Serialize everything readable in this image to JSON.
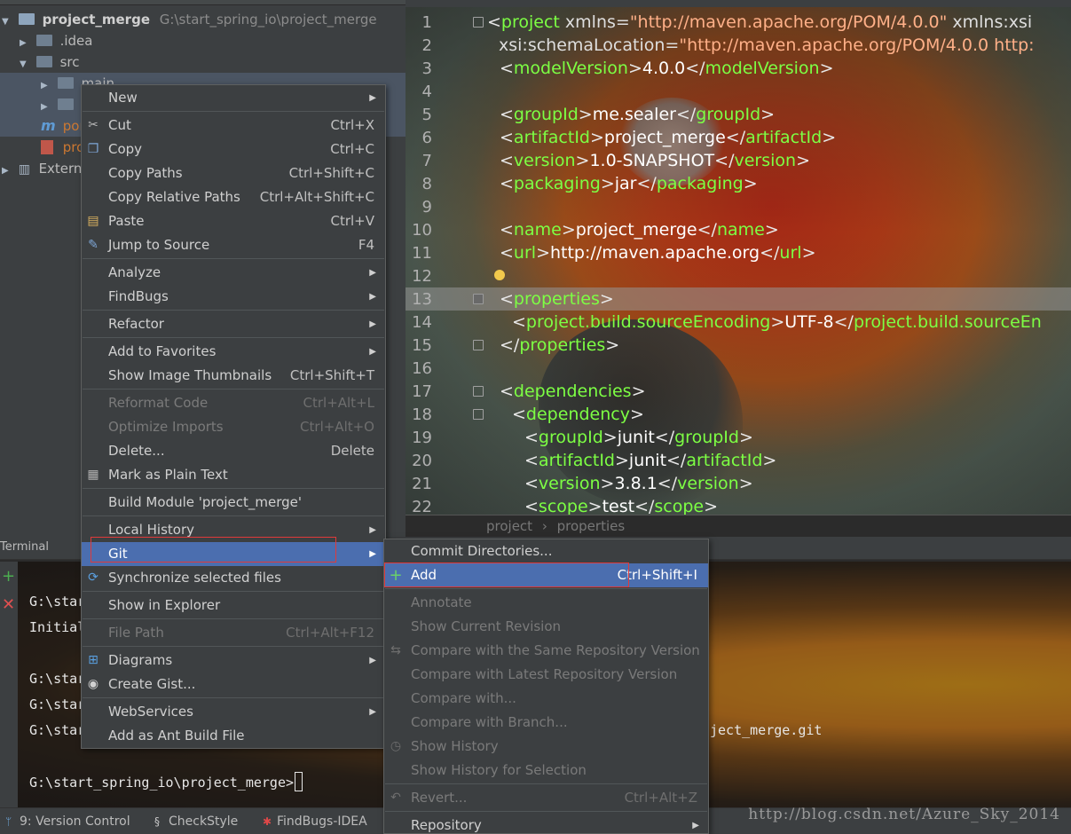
{
  "project": {
    "root_name": "project_merge",
    "root_path": "G:\\start_spring_io\\project_merge",
    "items": [
      {
        "label": ".idea"
      },
      {
        "label": "src"
      },
      {
        "label": "main"
      },
      {
        "label": ""
      },
      {
        "label": "pom"
      },
      {
        "label": "pro"
      },
      {
        "label": "Externa"
      }
    ]
  },
  "editor": {
    "lines": [
      {
        "n": "1"
      },
      {
        "n": "2"
      },
      {
        "n": "3"
      },
      {
        "n": "4"
      },
      {
        "n": "5"
      },
      {
        "n": "6"
      },
      {
        "n": "7"
      },
      {
        "n": "8"
      },
      {
        "n": "9"
      },
      {
        "n": "10"
      },
      {
        "n": "11"
      },
      {
        "n": "12"
      },
      {
        "n": "13"
      },
      {
        "n": "14"
      },
      {
        "n": "15"
      },
      {
        "n": "16"
      },
      {
        "n": "17"
      },
      {
        "n": "18"
      },
      {
        "n": "19"
      },
      {
        "n": "20"
      },
      {
        "n": "21"
      },
      {
        "n": "22"
      }
    ],
    "code": {
      "l1_tag": "project",
      "l1_attr1": " xmlns=",
      "l1_val1": "\"http://maven.apache.org/POM/4.0.0\"",
      "l1_attr2": " xmlns:xsi",
      "l2_attr": "xsi:schemaLocation=",
      "l2_val": "\"http://maven.apache.org/POM/4.0.0 http:",
      "modelVersion": "modelVersion",
      "modelVersion_val": "4.0.0",
      "groupId": "groupId",
      "groupId_val": "me.sealer",
      "artifactId": "artifactId",
      "artifactId_val": "project_merge",
      "version": "version",
      "version_val": "1.0-SNAPSHOT",
      "packaging": "packaging",
      "packaging_val": "jar",
      "name": "name",
      "name_val": "project_merge",
      "url": "url",
      "url_val": "http://maven.apache.org",
      "properties": "properties",
      "encoding": "project.build.sourceEncoding",
      "encoding_val": "UTF-8",
      "encoding_close": "project.build.sourceEn",
      "dependencies": "dependencies",
      "dependency": "dependency",
      "dep_groupId_val": "junit",
      "dep_artifactId_val": "junit",
      "dep_version_val": "3.8.1",
      "scope": "scope",
      "scope_val": "test"
    },
    "breadcrumb": [
      "project",
      "properties"
    ]
  },
  "terminal": {
    "title": "Terminal",
    "lines": [
      "G:\\star",
      "Initial",
      "G:\\star",
      "G:\\star",
      "G:\\star",
      "ject_merge.git",
      "G:\\start_spring_io\\project_merge>"
    ]
  },
  "statusbar": {
    "version_control": "9: Version Control",
    "checkstyle": "CheckStyle",
    "findbugs": "FindBugs-IDEA"
  },
  "watermark": "http://blog.csdn.net/Azure_Sky_2014",
  "context_menu": {
    "items": [
      {
        "label": "New"
      },
      {
        "label": "Cut",
        "shortcut": "Ctrl+X"
      },
      {
        "label": "Copy",
        "shortcut": "Ctrl+C"
      },
      {
        "label": "Copy Paths",
        "shortcut": "Ctrl+Shift+C"
      },
      {
        "label": "Copy Relative Paths",
        "shortcut": "Ctrl+Alt+Shift+C"
      },
      {
        "label": "Paste",
        "shortcut": "Ctrl+V"
      },
      {
        "label": "Jump to Source",
        "shortcut": "F4"
      },
      {
        "label": "Analyze"
      },
      {
        "label": "FindBugs"
      },
      {
        "label": "Refactor"
      },
      {
        "label": "Add to Favorites"
      },
      {
        "label": "Show Image Thumbnails",
        "shortcut": "Ctrl+Shift+T"
      },
      {
        "label": "Reformat Code",
        "shortcut": "Ctrl+Alt+L"
      },
      {
        "label": "Optimize Imports",
        "shortcut": "Ctrl+Alt+O"
      },
      {
        "label": "Delete...",
        "shortcut": "Delete"
      },
      {
        "label": "Mark as Plain Text"
      },
      {
        "label": "Build Module 'project_merge'"
      },
      {
        "label": "Local History"
      },
      {
        "label": "Git"
      },
      {
        "label": "Synchronize selected files"
      },
      {
        "label": "Show in Explorer"
      },
      {
        "label": "File Path",
        "shortcut": "Ctrl+Alt+F12"
      },
      {
        "label": "Diagrams"
      },
      {
        "label": "Create Gist..."
      },
      {
        "label": "WebServices"
      },
      {
        "label": "Add as Ant Build File"
      }
    ]
  },
  "git_menu": {
    "items": [
      {
        "label": "Commit Directories..."
      },
      {
        "label": "Add",
        "shortcut": "Ctrl+Shift+I"
      },
      {
        "label": "Annotate"
      },
      {
        "label": "Show Current Revision"
      },
      {
        "label": "Compare with the Same Repository Version"
      },
      {
        "label": "Compare with Latest Repository Version"
      },
      {
        "label": "Compare with..."
      },
      {
        "label": "Compare with Branch..."
      },
      {
        "label": "Show History"
      },
      {
        "label": "Show History for Selection"
      },
      {
        "label": "Revert...",
        "shortcut": "Ctrl+Alt+Z"
      },
      {
        "label": "Repository"
      }
    ]
  },
  "colors": {
    "menu_bg": "#3c3f41",
    "selection": "#4b6eaf",
    "highlight_box": "#e03a3a",
    "tag_green": "#7dff44"
  }
}
